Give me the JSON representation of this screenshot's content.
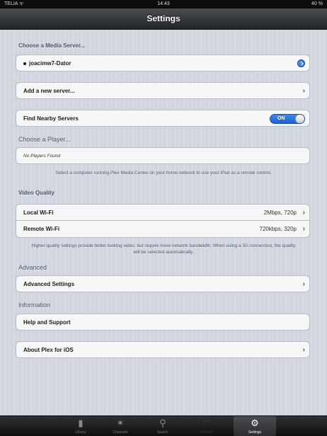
{
  "status_bar": {
    "carrier": "TELIA ᯤ",
    "time": "14:43",
    "battery": "40 %"
  },
  "nav": {
    "title": "Settings"
  },
  "media_server": {
    "header": "Choose a Media Server...",
    "selected_server": "joacimw7-Dator",
    "add_server_label": "Add a new server..."
  },
  "nearby": {
    "label": "Find Nearby Servers",
    "toggle_text": "ON"
  },
  "player": {
    "header": "Choose a Player...",
    "empty_text": "No Players Found",
    "footnote": "Select a computer running Plex Media Center on your home network to use your iPad as a remote control."
  },
  "video_quality": {
    "header": "Video Quality",
    "local_label": "Local Wi-Fi",
    "local_value": "2Mbps, 720p",
    "remote_label": "Remote Wi-Fi",
    "remote_value": "720kbps, 320p",
    "footnote": "Higher quality settings provide better looking video, but require more network bandwidth. When using a 3G connection, the quality will be selected automatically."
  },
  "advanced": {
    "header": "Advanced",
    "label": "Advanced Settings"
  },
  "information": {
    "header": "Information",
    "help_label": "Help and Support",
    "about_label": "About Plex for iOS"
  },
  "chevron": "›",
  "tabs": [
    {
      "label": "Library",
      "icon": "library-icon",
      "glyph": "▮",
      "selected": false
    },
    {
      "label": "Channels",
      "icon": "channels-icon",
      "glyph": "✶",
      "selected": false
    },
    {
      "label": "Search",
      "icon": "search-icon",
      "glyph": "⚲",
      "selected": false
    },
    {
      "label": "Remote",
      "icon": "wifi-icon",
      "glyph": "◠",
      "selected": false
    },
    {
      "label": "Settings",
      "icon": "gears-icon",
      "glyph": "⚙",
      "selected": true
    }
  ],
  "colors": {
    "toggle_on": "#2f74d8",
    "nav_bar": "#2c2e31",
    "background": "#d3d8e0"
  }
}
